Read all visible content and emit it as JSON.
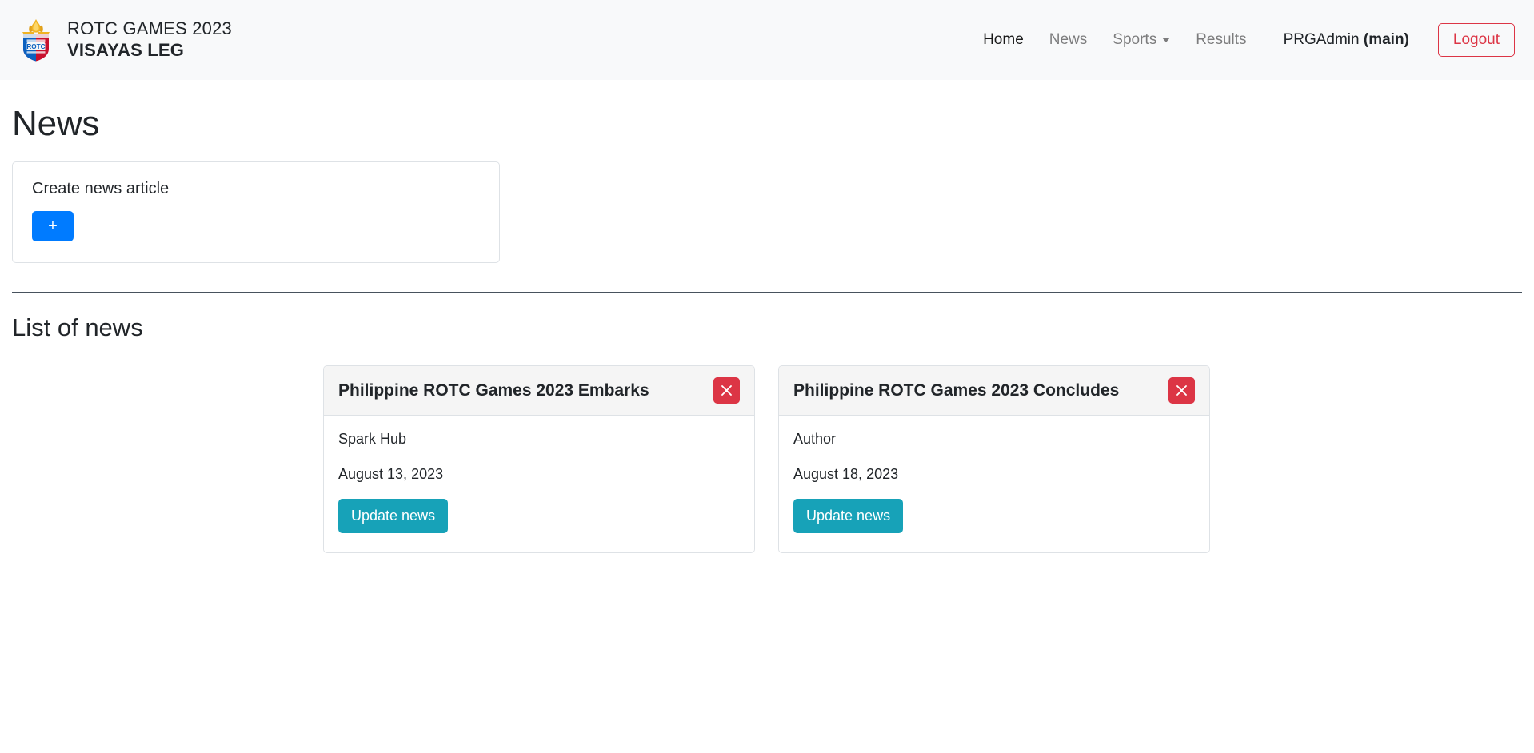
{
  "navbar": {
    "brand": {
      "logo_icon": "rotc-shield-flame-logo",
      "line1": "ROTC GAMES 2023",
      "line2": "VISAYAS LEG"
    },
    "links": [
      {
        "label": "Home",
        "active": true,
        "has_caret": false
      },
      {
        "label": "News",
        "active": false,
        "has_caret": false
      },
      {
        "label": "Sports",
        "active": false,
        "has_caret": true,
        "caret_icon": "chevron-down-icon"
      },
      {
        "label": "Results",
        "active": false,
        "has_caret": false
      }
    ],
    "user": {
      "name": "PRGAdmin",
      "role": "(main)"
    },
    "logout_label": "Logout"
  },
  "main": {
    "page_title": "News",
    "create_card": {
      "title": "Create news article",
      "add_button_label": "+",
      "add_button_icon": "plus-icon"
    },
    "section_title": "List of news",
    "news": [
      {
        "title": "Philippine ROTC Games 2023 Embarks",
        "author": "Spark Hub",
        "date": "August 13, 2023",
        "update_label": "Update news",
        "delete_icon": "close-x-icon"
      },
      {
        "title": "Philippine ROTC Games 2023 Concludes",
        "author": "Author",
        "date": "August 18, 2023",
        "update_label": "Update news",
        "delete_icon": "close-x-icon"
      }
    ]
  },
  "colors": {
    "navbar_bg": "#f8f9fa",
    "primary": "#007bff",
    "danger": "#dc3545",
    "info": "#17a2b8",
    "card_header_bg": "#f5f5f5",
    "border": "#dee2e6",
    "divider": "#47525d",
    "text": "#212529",
    "muted": "rgba(0,0,0,.5)"
  }
}
